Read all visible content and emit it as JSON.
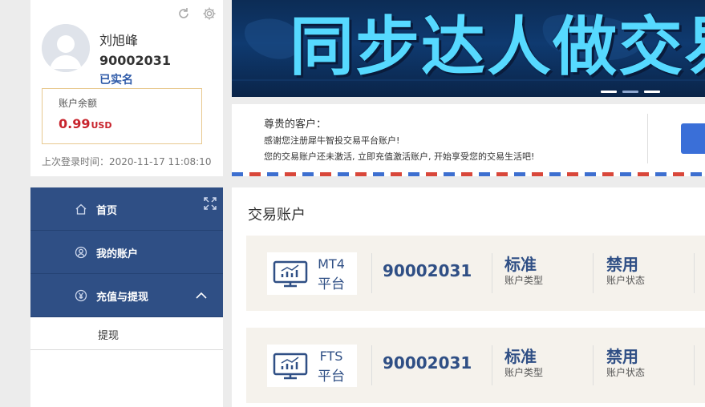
{
  "profile": {
    "username": "刘旭峰",
    "account_id": "90002031",
    "verified": "已实名",
    "balance_label": "账户余额",
    "balance_value": "0.99",
    "balance_currency": "USD",
    "last_login": "上次登录时间：2020-11-17 11:08:10"
  },
  "nav": {
    "items": [
      {
        "label": "首页",
        "icon": "home-icon"
      },
      {
        "label": "我的账户",
        "icon": "user-circle-icon"
      },
      {
        "label": "充值与提现",
        "icon": "yen-circle-icon"
      }
    ],
    "subitems": [
      {
        "label": "提现"
      }
    ]
  },
  "banner": {
    "title": "同步达人做交易"
  },
  "notice": {
    "greeting": "尊贵的客户：",
    "line1": "感谢您注册犀牛智投交易平台账户!",
    "line2": "您的交易账户还未激活, 立即充值激活账户, 开始享受您的交易生活吧!"
  },
  "accounts": {
    "heading": "交易账户",
    "rows": [
      {
        "platform": "MT4",
        "platform_suffix": "平台",
        "number": "90002031",
        "type_value": "标准",
        "type_label": "账户类型",
        "status_value": "禁用",
        "status_label": "账户状态"
      },
      {
        "platform": "FTS",
        "platform_suffix": "平台",
        "number": "90002031",
        "type_value": "标准",
        "type_label": "账户类型",
        "status_value": "禁用",
        "status_label": "账户状态"
      }
    ]
  },
  "colors": {
    "nav_bg": "#2f4f85",
    "accent_blue": "#2f4f85",
    "balance_red": "#c8242d",
    "balance_border": "#e8c98f"
  }
}
